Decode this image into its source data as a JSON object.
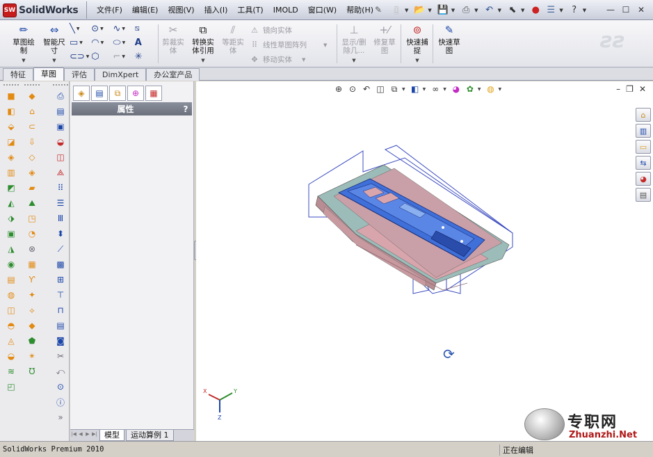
{
  "app": {
    "logo_badge": "SW",
    "logo_text": "SolidWorks"
  },
  "menu": [
    "文件(F)",
    "编辑(E)",
    "视图(V)",
    "插入(I)",
    "工具(T)",
    "IMOLD",
    "窗口(W)",
    "帮助(H)"
  ],
  "ribbon": {
    "sketch": "草图绘\n制",
    "smart_dim": "智能尺\n寸",
    "trim": "剪裁实\n体",
    "convert": "转换实\n体引用",
    "offset": "等距实\n体",
    "mirror": "镜向实体",
    "linear_pattern": "线性草图阵列",
    "move": "移动实体",
    "display_delete": "显示/删\n除几...",
    "repair": "修复草\n图",
    "quick_snap": "快速捕\n捉",
    "rapid_sketch": "快速草\n图"
  },
  "cm_tabs": [
    "特征",
    "草图",
    "评估",
    "DimXpert",
    "办公室产品"
  ],
  "cm_active": "草图",
  "property_manager": {
    "title": "属性",
    "help": "?"
  },
  "bottom_tabs": [
    "模型",
    "运动算例 1"
  ],
  "watermark": {
    "cn": "专职网",
    "en": "Zhuanzhi.Net"
  },
  "triad": {
    "x": "X",
    "y": "Y",
    "z": "Z"
  },
  "status": {
    "left": "SolidWorks Premium 2010",
    "right": "正在编辑"
  },
  "colors": {
    "accent": "#1b46a8",
    "ribbon_bg": "#e3e4ea",
    "model_blue": "#3f6fd8",
    "mold_pink": "#c98a8a"
  }
}
